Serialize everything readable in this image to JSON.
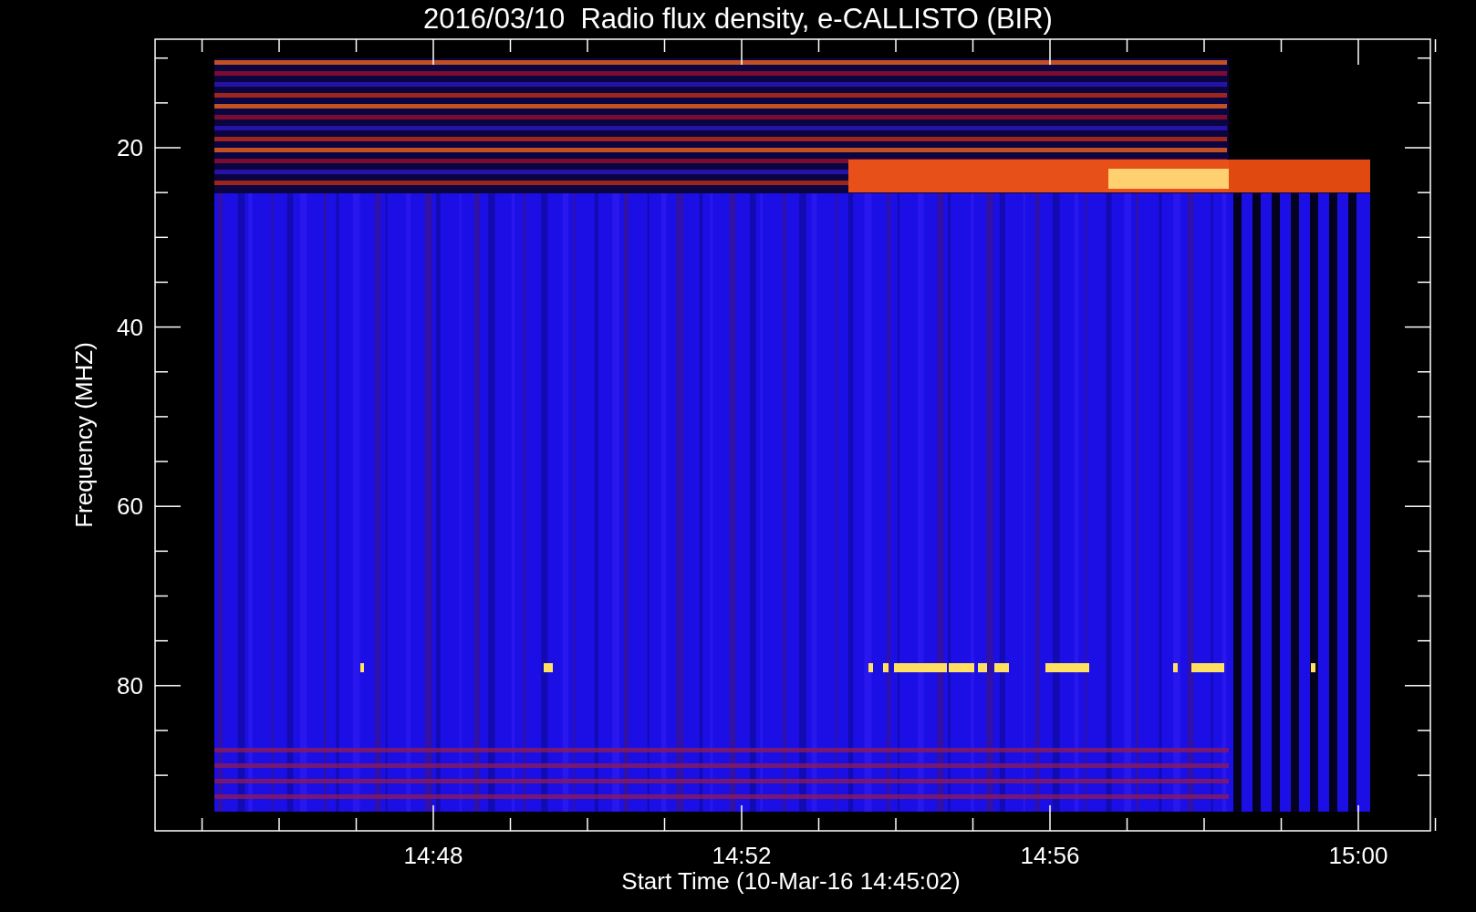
{
  "chart": {
    "title": "2016/03/10  Radio flux density, e-CALLISTO (BIR)",
    "ylabel": "Frequency (MHZ)",
    "xlabel": "Start Time (10-Mar-16 14:45:02)",
    "yticks": [
      "20",
      "40",
      "60",
      "80"
    ],
    "xticks": [
      "14:48",
      "14:52",
      "14:56",
      "15:00"
    ]
  }
}
